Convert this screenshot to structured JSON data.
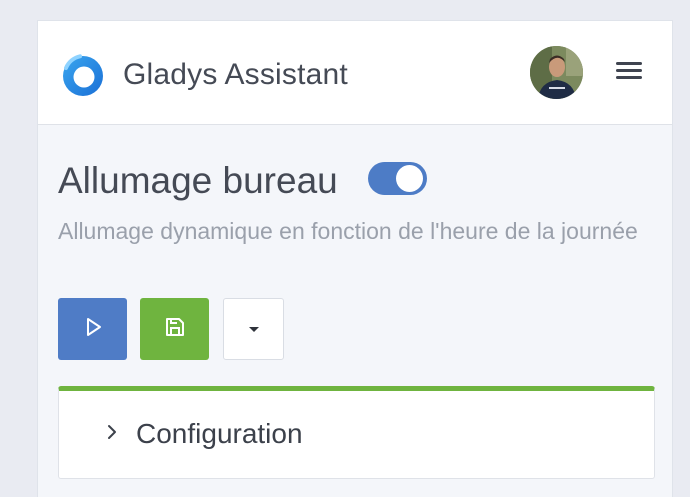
{
  "header": {
    "app_title": "Gladys Assistant",
    "logo_icon": "gladys-logo-icon",
    "avatar_icon": "user-avatar",
    "menu_icon": "hamburger-menu-icon"
  },
  "scene": {
    "title": "Allumage bureau",
    "enabled": true,
    "description": "Allumage dynamique en fonction de l'heure de la journée"
  },
  "actions": {
    "run_icon": "play-icon",
    "save_icon": "save-icon",
    "more_icon": "caret-down-icon"
  },
  "config_section": {
    "label": "Configuration",
    "icon": "chevron-right-icon"
  },
  "colors": {
    "primary": "#4f7cc6",
    "success": "#6fb43f",
    "text": "#454a55",
    "muted": "#9aa0ab"
  }
}
